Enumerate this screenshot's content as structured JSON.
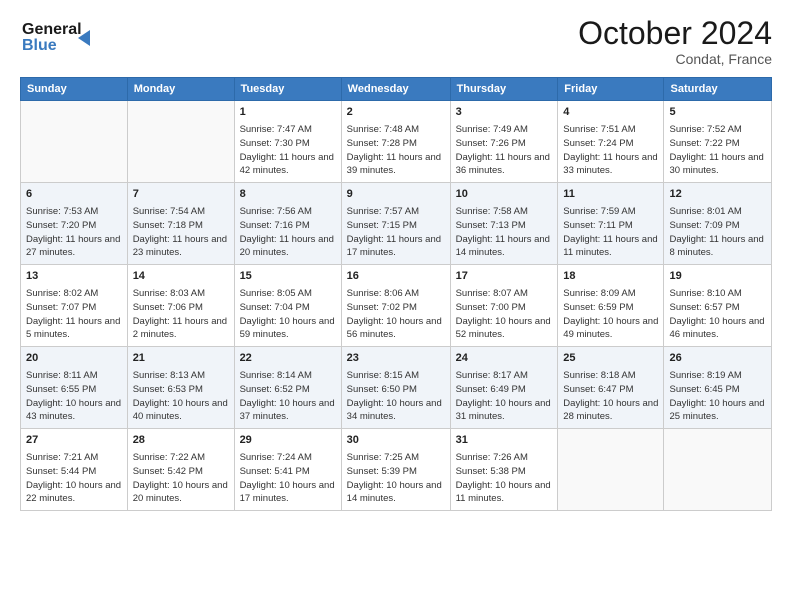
{
  "header": {
    "logo_line1": "General",
    "logo_line2": "Blue",
    "month": "October 2024",
    "location": "Condat, France"
  },
  "days_of_week": [
    "Sunday",
    "Monday",
    "Tuesday",
    "Wednesday",
    "Thursday",
    "Friday",
    "Saturday"
  ],
  "weeks": [
    [
      {
        "num": "",
        "info": ""
      },
      {
        "num": "",
        "info": ""
      },
      {
        "num": "1",
        "info": "Sunrise: 7:47 AM\nSunset: 7:30 PM\nDaylight: 11 hours and 42 minutes."
      },
      {
        "num": "2",
        "info": "Sunrise: 7:48 AM\nSunset: 7:28 PM\nDaylight: 11 hours and 39 minutes."
      },
      {
        "num": "3",
        "info": "Sunrise: 7:49 AM\nSunset: 7:26 PM\nDaylight: 11 hours and 36 minutes."
      },
      {
        "num": "4",
        "info": "Sunrise: 7:51 AM\nSunset: 7:24 PM\nDaylight: 11 hours and 33 minutes."
      },
      {
        "num": "5",
        "info": "Sunrise: 7:52 AM\nSunset: 7:22 PM\nDaylight: 11 hours and 30 minutes."
      }
    ],
    [
      {
        "num": "6",
        "info": "Sunrise: 7:53 AM\nSunset: 7:20 PM\nDaylight: 11 hours and 27 minutes."
      },
      {
        "num": "7",
        "info": "Sunrise: 7:54 AM\nSunset: 7:18 PM\nDaylight: 11 hours and 23 minutes."
      },
      {
        "num": "8",
        "info": "Sunrise: 7:56 AM\nSunset: 7:16 PM\nDaylight: 11 hours and 20 minutes."
      },
      {
        "num": "9",
        "info": "Sunrise: 7:57 AM\nSunset: 7:15 PM\nDaylight: 11 hours and 17 minutes."
      },
      {
        "num": "10",
        "info": "Sunrise: 7:58 AM\nSunset: 7:13 PM\nDaylight: 11 hours and 14 minutes."
      },
      {
        "num": "11",
        "info": "Sunrise: 7:59 AM\nSunset: 7:11 PM\nDaylight: 11 hours and 11 minutes."
      },
      {
        "num": "12",
        "info": "Sunrise: 8:01 AM\nSunset: 7:09 PM\nDaylight: 11 hours and 8 minutes."
      }
    ],
    [
      {
        "num": "13",
        "info": "Sunrise: 8:02 AM\nSunset: 7:07 PM\nDaylight: 11 hours and 5 minutes."
      },
      {
        "num": "14",
        "info": "Sunrise: 8:03 AM\nSunset: 7:06 PM\nDaylight: 11 hours and 2 minutes."
      },
      {
        "num": "15",
        "info": "Sunrise: 8:05 AM\nSunset: 7:04 PM\nDaylight: 10 hours and 59 minutes."
      },
      {
        "num": "16",
        "info": "Sunrise: 8:06 AM\nSunset: 7:02 PM\nDaylight: 10 hours and 56 minutes."
      },
      {
        "num": "17",
        "info": "Sunrise: 8:07 AM\nSunset: 7:00 PM\nDaylight: 10 hours and 52 minutes."
      },
      {
        "num": "18",
        "info": "Sunrise: 8:09 AM\nSunset: 6:59 PM\nDaylight: 10 hours and 49 minutes."
      },
      {
        "num": "19",
        "info": "Sunrise: 8:10 AM\nSunset: 6:57 PM\nDaylight: 10 hours and 46 minutes."
      }
    ],
    [
      {
        "num": "20",
        "info": "Sunrise: 8:11 AM\nSunset: 6:55 PM\nDaylight: 10 hours and 43 minutes."
      },
      {
        "num": "21",
        "info": "Sunrise: 8:13 AM\nSunset: 6:53 PM\nDaylight: 10 hours and 40 minutes."
      },
      {
        "num": "22",
        "info": "Sunrise: 8:14 AM\nSunset: 6:52 PM\nDaylight: 10 hours and 37 minutes."
      },
      {
        "num": "23",
        "info": "Sunrise: 8:15 AM\nSunset: 6:50 PM\nDaylight: 10 hours and 34 minutes."
      },
      {
        "num": "24",
        "info": "Sunrise: 8:17 AM\nSunset: 6:49 PM\nDaylight: 10 hours and 31 minutes."
      },
      {
        "num": "25",
        "info": "Sunrise: 8:18 AM\nSunset: 6:47 PM\nDaylight: 10 hours and 28 minutes."
      },
      {
        "num": "26",
        "info": "Sunrise: 8:19 AM\nSunset: 6:45 PM\nDaylight: 10 hours and 25 minutes."
      }
    ],
    [
      {
        "num": "27",
        "info": "Sunrise: 7:21 AM\nSunset: 5:44 PM\nDaylight: 10 hours and 22 minutes."
      },
      {
        "num": "28",
        "info": "Sunrise: 7:22 AM\nSunset: 5:42 PM\nDaylight: 10 hours and 20 minutes."
      },
      {
        "num": "29",
        "info": "Sunrise: 7:24 AM\nSunset: 5:41 PM\nDaylight: 10 hours and 17 minutes."
      },
      {
        "num": "30",
        "info": "Sunrise: 7:25 AM\nSunset: 5:39 PM\nDaylight: 10 hours and 14 minutes."
      },
      {
        "num": "31",
        "info": "Sunrise: 7:26 AM\nSunset: 5:38 PM\nDaylight: 10 hours and 11 minutes."
      },
      {
        "num": "",
        "info": ""
      },
      {
        "num": "",
        "info": ""
      }
    ]
  ]
}
